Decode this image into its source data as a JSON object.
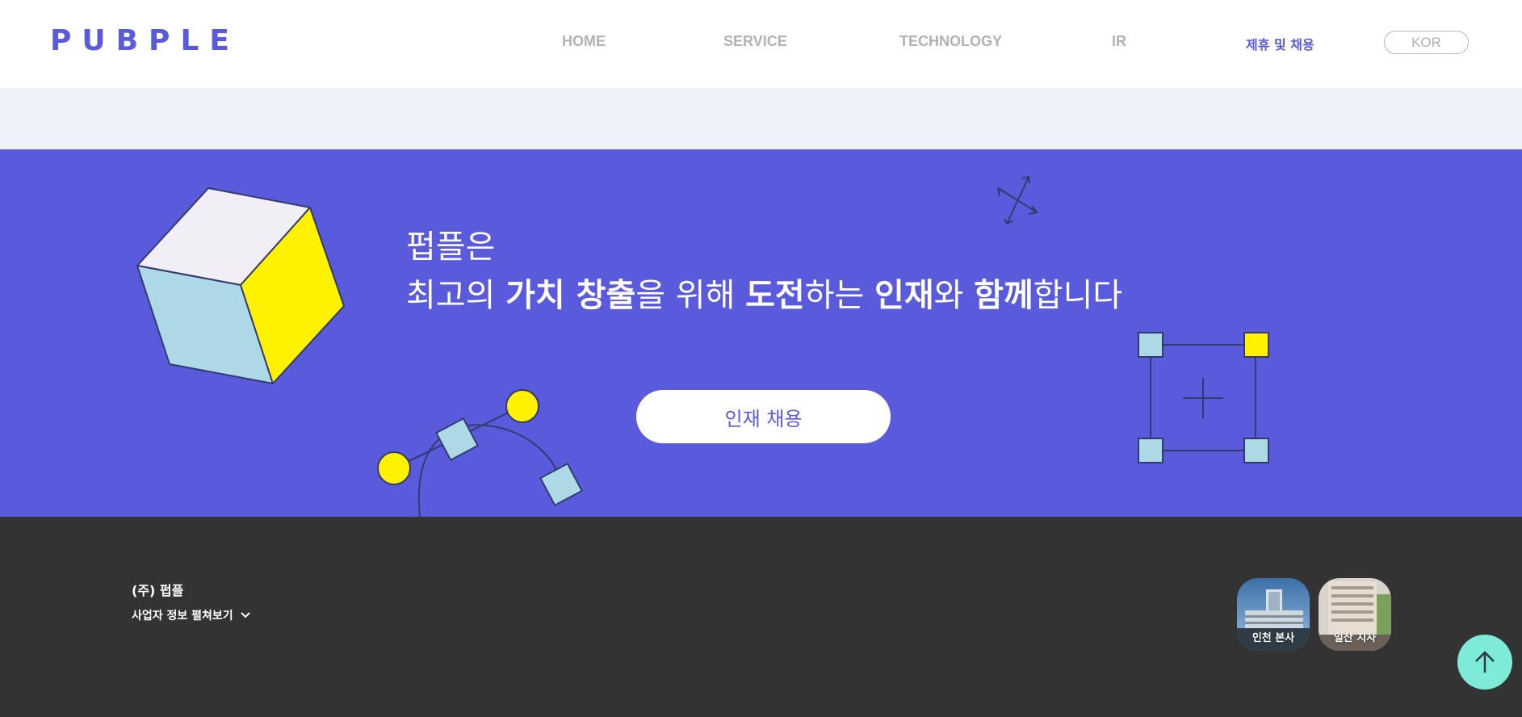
{
  "header": {
    "logo": "PUBPLE",
    "nav": [
      {
        "label": "HOME"
      },
      {
        "label": "SERVICE"
      },
      {
        "label": "TECHNOLOGY"
      },
      {
        "label": "IR"
      },
      {
        "label": "제휴 및 채용"
      }
    ],
    "lang": "KOR"
  },
  "hero": {
    "line1": "펍플은",
    "line2": {
      "p1": "최고의 ",
      "b1": "가치 창출",
      "p2": "을 위해 ",
      "b2": "도전",
      "p3": "하는 ",
      "b3": "인재",
      "p4": "와 ",
      "b4": "함께",
      "p5": "합니다"
    },
    "button": "인재 채용"
  },
  "footer": {
    "company": "(주) 펍플",
    "biz_toggle": "사업자 정보 펼쳐보기",
    "sites": [
      {
        "label": "인천 본사"
      },
      {
        "label": "일산 지사"
      }
    ]
  },
  "colors": {
    "brand": "#5a5bdc",
    "cube_top": "#f1eef5",
    "cube_left": "#add8e6",
    "cube_right": "#fff200",
    "footer_bg": "#333333",
    "top_button": "#7debd8"
  },
  "icons": {
    "chevron": "chevron-down-icon",
    "top": "arrow-up-icon"
  }
}
